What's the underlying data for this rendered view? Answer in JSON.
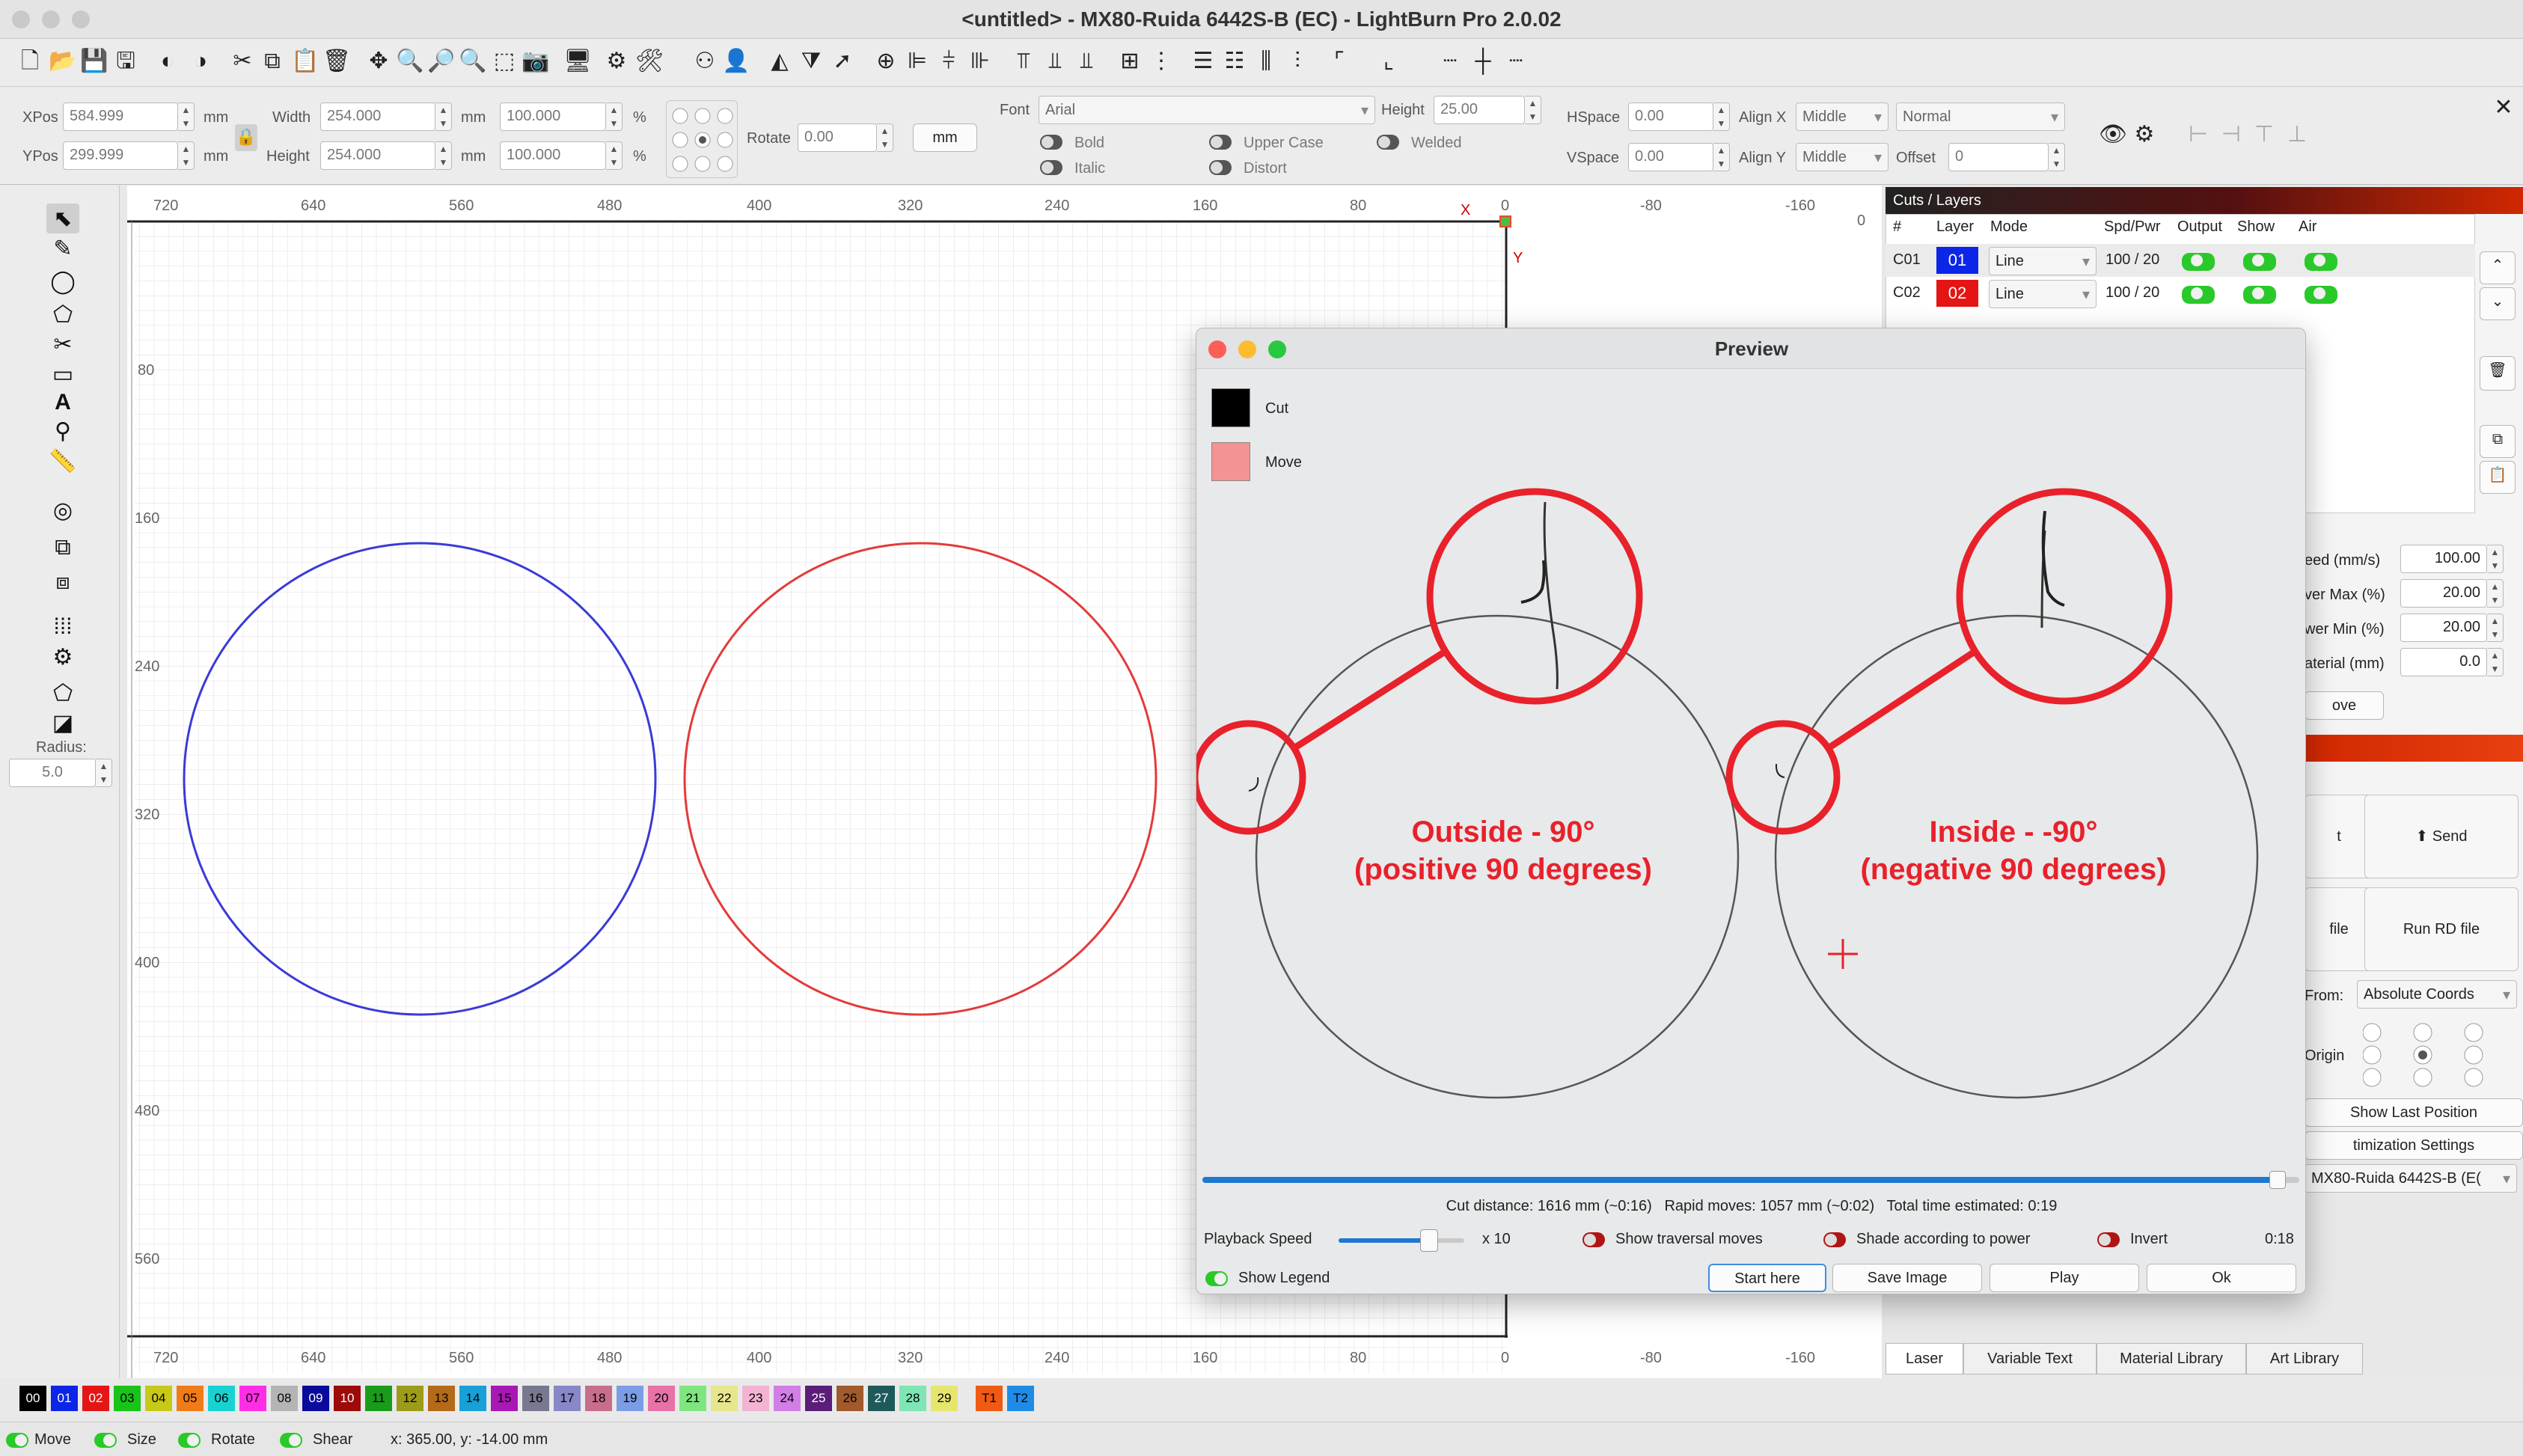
{
  "window": {
    "title": "<untitled> - MX80-Ruida 6442S-B (EC) - LightBurn Pro 2.0.02"
  },
  "props": {
    "xpos_label": "XPos",
    "xpos": "584.999",
    "ypos_label": "YPos",
    "ypos": "299.999",
    "mm": "mm",
    "pct": "%",
    "width_label": "Width",
    "width": "254.000",
    "height_label": "Height",
    "height": "254.000",
    "wpct": "100.000",
    "hpct": "100.000",
    "rotate_label": "Rotate",
    "rotate": "0.00",
    "unit_btn": "mm",
    "font_label": "Font",
    "font": "Arial",
    "font_height_label": "Height",
    "font_height": "25.00",
    "bold": "Bold",
    "italic": "Italic",
    "upper": "Upper Case",
    "distort": "Distort",
    "welded": "Welded",
    "hspace_label": "HSpace",
    "hspace": "0.00",
    "vspace_label": "VSpace",
    "vspace": "0.00",
    "alignx_label": "Align X",
    "alignx": "Middle",
    "aligny_label": "Align Y",
    "aligny": "Middle",
    "mode": "Normal",
    "offset_label": "Offset",
    "offset": "0"
  },
  "leftbar": {
    "radius_label": "Radius:",
    "radius": "5.0"
  },
  "ruler": {
    "top": [
      "720",
      "640",
      "560",
      "480",
      "400",
      "320",
      "240",
      "160",
      "80",
      "X",
      "0",
      "-80",
      "-160",
      "0"
    ],
    "left": [
      "80",
      "160",
      "240",
      "320",
      "400",
      "480",
      "560",
      "Y"
    ],
    "bottom": [
      "720",
      "640",
      "560",
      "480",
      "400",
      "320",
      "240",
      "160",
      "80",
      "0",
      "-80",
      "-160"
    ]
  },
  "cuts": {
    "title": "Cuts / Layers",
    "headers": [
      "#",
      "Layer",
      "Mode",
      "Spd/Pwr",
      "Output",
      "Show",
      "Air"
    ],
    "rows": [
      {
        "id": "C01",
        "layer": "01",
        "mode": "Line",
        "spdpwr": "100 / 20",
        "color": "#0b26e6"
      },
      {
        "id": "C02",
        "layer": "02",
        "mode": "Line",
        "spdpwr": "100 / 20",
        "color": "#e51515"
      }
    ],
    "fields": [
      {
        "label": "eed (mm/s)",
        "value": "100.00"
      },
      {
        "label": "ver Max (%)",
        "value": "20.00"
      },
      {
        "label": "wer Min (%)",
        "value": "20.00"
      },
      {
        "label": "aterial (mm)",
        "value": "0.0"
      }
    ],
    "move_btn": "ove"
  },
  "laser": {
    "send": "Send",
    "file_left": "file",
    "run_rd": "Run RD file",
    "t_left": "t",
    "start_from_label": "From:",
    "start_from": "Absolute Coords",
    "origin_label": "Origin",
    "show_last": "Show Last Position",
    "opt": "timization Settings",
    "device": "MX80-Ruida 6442S-B (E("
  },
  "tabs": [
    "Laser",
    "Variable Text",
    "Material Library",
    "Art Library"
  ],
  "preview": {
    "title": "Preview",
    "legend": [
      {
        "label": "Cut",
        "color": "#000000"
      },
      {
        "label": "Move",
        "color": "#f39393"
      }
    ],
    "annot_outside_1": "Outside - 90°",
    "annot_outside_2": "(positive 90 degrees)",
    "annot_inside_1": "Inside -  -90°",
    "annot_inside_2": "(negative 90 degrees)",
    "stats": "Cut distance: 1616 mm (~0:16)   Rapid moves: 1057 mm (~0:02)   Total time estimated: 0:19",
    "progress": 0.98,
    "playback_label": "Playback Speed",
    "speed_mult": "x 10",
    "speed_slider": 0.72,
    "show_traversal": "Show traversal moves",
    "shade": "Shade according to power",
    "invert": "Invert",
    "time": "0:18",
    "show_legend": "Show Legend",
    "buttons": [
      "Start here",
      "Save Image",
      "Play",
      "Ok"
    ]
  },
  "palette": {
    "items": [
      {
        "label": "00",
        "color": "#000000",
        "fg": "#ffffff"
      },
      {
        "label": "01",
        "color": "#0b26e6",
        "fg": "#ffffff"
      },
      {
        "label": "02",
        "color": "#e51515",
        "fg": "#ffffff"
      },
      {
        "label": "03",
        "color": "#18c418",
        "fg": "#000000"
      },
      {
        "label": "04",
        "color": "#c8c816",
        "fg": "#000000"
      },
      {
        "label": "05",
        "color": "#f07c18",
        "fg": "#000000"
      },
      {
        "label": "06",
        "color": "#18d2d2",
        "fg": "#000000"
      },
      {
        "label": "07",
        "color": "#ff2ee6",
        "fg": "#000000"
      },
      {
        "label": "08",
        "color": "#b4b4b4",
        "fg": "#000000"
      },
      {
        "label": "09",
        "color": "#0a0a9c",
        "fg": "#ffffff"
      },
      {
        "label": "10",
        "color": "#9c0a0a",
        "fg": "#ffffff"
      },
      {
        "label": "11",
        "color": "#1a9c1a",
        "fg": "#000000"
      },
      {
        "label": "12",
        "color": "#9c9c18",
        "fg": "#000000"
      },
      {
        "label": "13",
        "color": "#b46a18",
        "fg": "#000000"
      },
      {
        "label": "14",
        "color": "#18a0d8",
        "fg": "#000000"
      },
      {
        "label": "15",
        "color": "#a818b4",
        "fg": "#000000"
      },
      {
        "label": "16",
        "color": "#787890",
        "fg": "#000000"
      },
      {
        "label": "17",
        "color": "#8888c8",
        "fg": "#000000"
      },
      {
        "label": "18",
        "color": "#c86e8c",
        "fg": "#000000"
      },
      {
        "label": "19",
        "color": "#7c9ce6",
        "fg": "#000000"
      },
      {
        "label": "20",
        "color": "#e672a6",
        "fg": "#000000"
      },
      {
        "label": "21",
        "color": "#7ee67e",
        "fg": "#000000"
      },
      {
        "label": "22",
        "color": "#e6e68c",
        "fg": "#000000"
      },
      {
        "label": "23",
        "color": "#f2b4d2",
        "fg": "#000000"
      },
      {
        "label": "24",
        "color": "#d27ee6",
        "fg": "#000000"
      },
      {
        "label": "25",
        "color": "#5a1e78",
        "fg": "#ffffff"
      },
      {
        "label": "26",
        "color": "#a05a2c",
        "fg": "#000000"
      },
      {
        "label": "27",
        "color": "#1e5a5a",
        "fg": "#ffffff"
      },
      {
        "label": "28",
        "color": "#7ee6b4",
        "fg": "#000000"
      },
      {
        "label": "29",
        "color": "#e6e66e",
        "fg": "#000000"
      },
      {
        "label": "T1",
        "color": "#f05a14",
        "fg": "#000000"
      },
      {
        "label": "T2",
        "color": "#1e8ce6",
        "fg": "#000000"
      }
    ]
  },
  "status": {
    "move": "Move",
    "size": "Size",
    "rotate": "Rotate",
    "shear": "Shear",
    "coords": "x: 365.00, y: -14.00 mm"
  },
  "colors": {
    "accent_red": "#e8212b",
    "blue_circle": "#3a3ad8",
    "red_circle": "#e43a3a",
    "grid": "#dcdcdc"
  }
}
